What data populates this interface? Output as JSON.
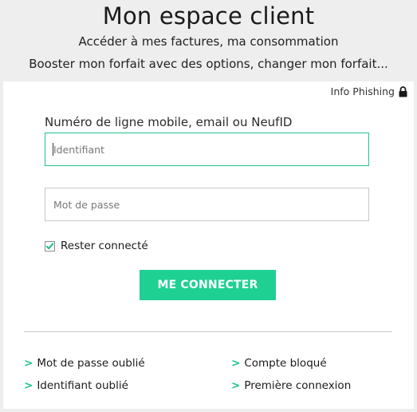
{
  "header": {
    "title": "Mon espace client",
    "subtitle_line1": "Accéder à mes factures, ma consommation",
    "subtitle_line2": "Booster mon forfait avec des options, changer mon forfait..."
  },
  "card": {
    "phishing_label": "Info Phishing",
    "phishing_icon": "lock-icon",
    "login_label": "Numéro de ligne mobile, email ou NeufID",
    "identifier": {
      "value": "",
      "placeholder": "Identifiant"
    },
    "password": {
      "value": "",
      "placeholder": "Mot de passe"
    },
    "remember": {
      "label": "Rester connecté",
      "checked": true
    },
    "submit_label": "ME CONNECTER",
    "links": [
      {
        "arrow": ">",
        "label": "Mot de passe oublié"
      },
      {
        "arrow": ">",
        "label": "Identifiant oublié"
      },
      {
        "arrow": ">",
        "label": "Compte bloqué"
      },
      {
        "arrow": ">",
        "label": "Première connexion"
      }
    ]
  },
  "colors": {
    "accent": "#1fd093",
    "background": "#eeeeee",
    "card": "#ffffff",
    "text": "#222222"
  }
}
